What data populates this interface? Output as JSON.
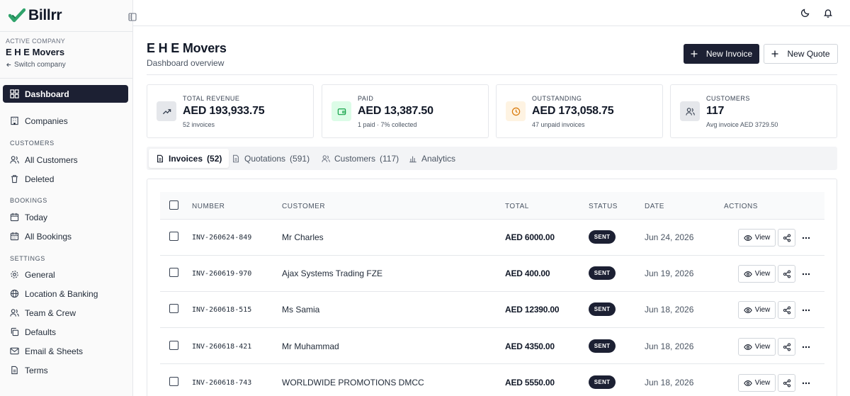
{
  "brand": {
    "name": "Billrr",
    "accent": "#2fa36b"
  },
  "company": {
    "active_label": "ACTIVE COMPANY",
    "name": "E H E Movers",
    "switch_label": "Switch company"
  },
  "nav": {
    "dashboard": "Dashboard",
    "companies": "Companies",
    "customers_section": "CUSTOMERS",
    "all_customers": "All Customers",
    "deleted": "Deleted",
    "bookings_section": "BOOKINGS",
    "today": "Today",
    "all_bookings": "All Bookings",
    "settings_section": "SETTINGS",
    "general": "General",
    "location_banking": "Location & Banking",
    "team_crew": "Team & Crew",
    "defaults": "Defaults",
    "email_sheets": "Email & Sheets",
    "terms": "Terms"
  },
  "header": {
    "title": "E H E Movers",
    "subtitle": "Dashboard overview",
    "new_invoice": "New Invoice",
    "new_quote": "New Quote"
  },
  "stats": [
    {
      "label": "TOTAL REVENUE",
      "value": "AED 193,933.75",
      "sub": "52 invoices",
      "icon": "trending-up-icon",
      "bg": "#e5e7eb",
      "fg": "#374151"
    },
    {
      "label": "PAID",
      "value": "AED 13,387.50",
      "sub": "1 paid · 7% collected",
      "icon": "wallet-icon",
      "bg": "#dcfce7",
      "fg": "#16a34a"
    },
    {
      "label": "OUTSTANDING",
      "value": "AED 173,058.75",
      "sub": "47 unpaid invoices",
      "icon": "clock-icon",
      "bg": "#fef3e2",
      "fg": "#d97706"
    },
    {
      "label": "CUSTOMERS",
      "value": "117",
      "sub": "Avg invoice AED 3729.50",
      "icon": "users-icon",
      "bg": "#e5e7eb",
      "fg": "#374151"
    }
  ],
  "tabs": [
    {
      "label": "Invoices",
      "count": "(52)"
    },
    {
      "label": "Quotations",
      "count": "(591)"
    },
    {
      "label": "Customers",
      "count": "(117)"
    },
    {
      "label": "Analytics",
      "count": ""
    }
  ],
  "table": {
    "columns": {
      "number": "NUMBER",
      "customer": "CUSTOMER",
      "total": "TOTAL",
      "status": "STATUS",
      "date": "DATE",
      "actions": "ACTIONS"
    },
    "view_label": "View",
    "rows": [
      {
        "number": "INV-260624-849",
        "customer": "Mr Charles",
        "total": "AED 6000.00",
        "status": "SENT",
        "date": "Jun 24, 2026"
      },
      {
        "number": "INV-260619-970",
        "customer": "Ajax Systems Trading FZE",
        "total": "AED 400.00",
        "status": "SENT",
        "date": "Jun 19, 2026"
      },
      {
        "number": "INV-260618-515",
        "customer": "Ms Samia",
        "total": "AED 12390.00",
        "status": "SENT",
        "date": "Jun 18, 2026"
      },
      {
        "number": "INV-260618-421",
        "customer": "Mr Muhammad",
        "total": "AED 4350.00",
        "status": "SENT",
        "date": "Jun 18, 2026"
      },
      {
        "number": "INV-260618-743",
        "customer": "WORLDWIDE PROMOTIONS DMCC",
        "total": "AED 5550.00",
        "status": "SENT",
        "date": "Jun 18, 2026"
      }
    ]
  }
}
